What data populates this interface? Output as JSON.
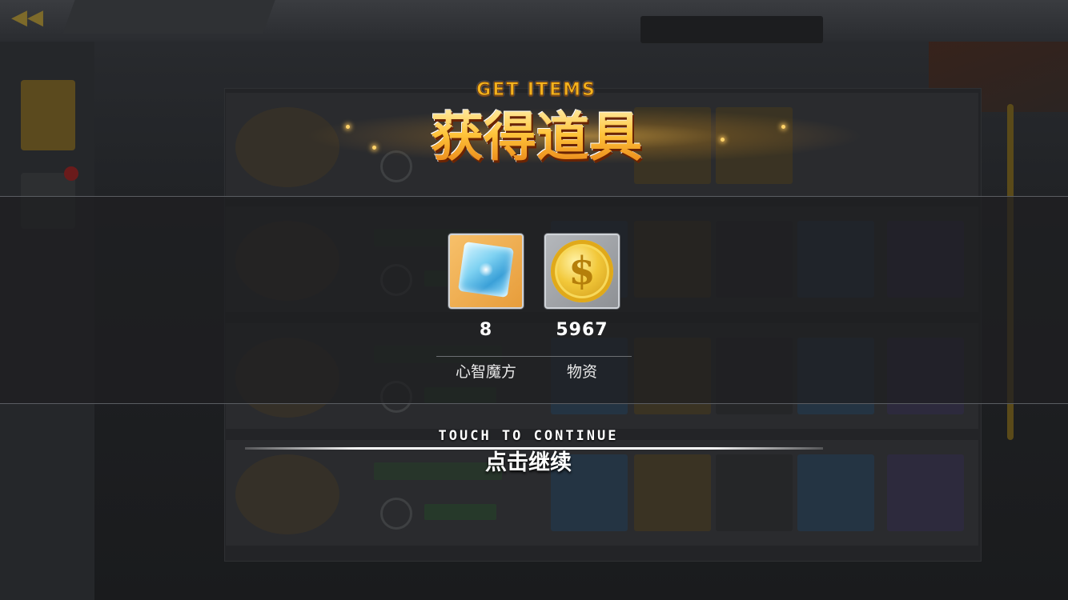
{
  "title": {
    "en": "GET ITEMS",
    "zh": "获得道具"
  },
  "items": [
    {
      "name": "心智魔方",
      "quantity": "8",
      "icon": "mind-cube-icon"
    },
    {
      "name": "物资",
      "quantity": "5967",
      "icon": "supply-coin-icon"
    }
  ],
  "continue_prompt": {
    "en": "TOUCH TO CONTINUE",
    "zh": "点击继续"
  },
  "colors": {
    "title_gold": "#ffc43a",
    "overlay_band": "#1e1f21",
    "cube_frame": "#e79d3b",
    "coin_frame": "#8e9195"
  }
}
